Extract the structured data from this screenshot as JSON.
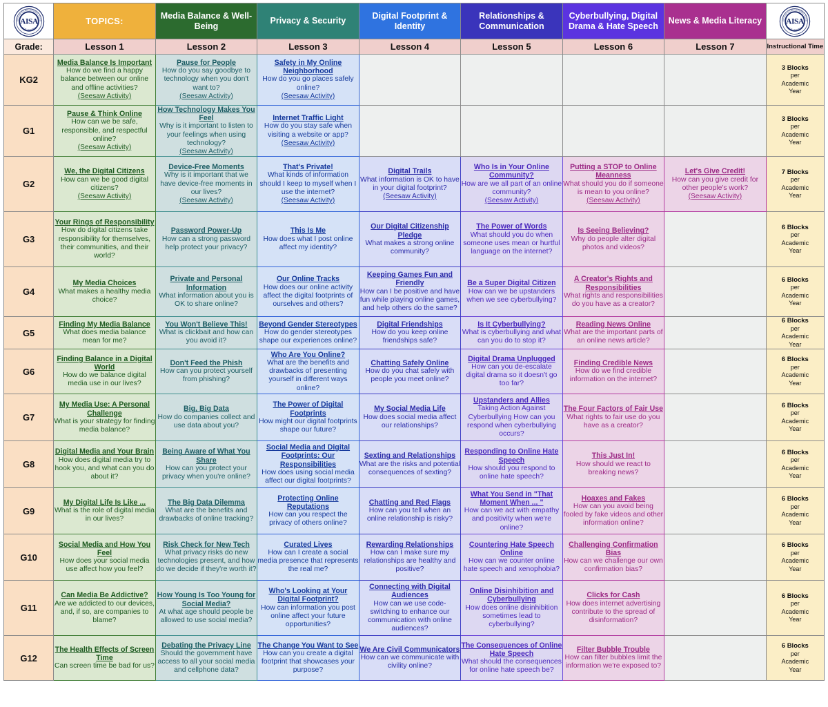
{
  "header": {
    "logo_alt": "AISA American International School Abu Dhabi",
    "topics_label": "TOPICS:",
    "strands": [
      "Media Balance & Well-Being",
      "Privacy & Security",
      "Digital Footprint & Identity",
      "Relationships & Communication",
      "Cyberbullying, Digital Drama & Hate Speech",
      "News & Media Literacy"
    ],
    "grade_label": "Grade:",
    "lesson_labels": [
      "Lesson 1",
      "Lesson 2",
      "Lesson 3",
      "Lesson 4",
      "Lesson 5",
      "Lesson 6",
      "Lesson 7"
    ],
    "time_label": "Instructional Time"
  },
  "colors": {
    "topics": "#efb13c",
    "media_balance": "#2c6b2f",
    "privacy": "#2f8276",
    "footprint": "#2f73e0",
    "relationships": "#3a34bb",
    "cyberbullying": "#5b33e0",
    "news": "#a9308f",
    "grade_col": "#fadfc4",
    "lesson_hdr": "#f0cfcc",
    "time_col": "#fbeec6"
  },
  "seesaw_label": "(Seesaw Activity)",
  "rows": [
    {
      "grade": "KG2",
      "time": {
        "blocks": "3 Blocks",
        "per": "per",
        "academic": "Academic",
        "year": "Year"
      },
      "cells": [
        {
          "title": "Media Balance Is Important",
          "question": "How do we find a happy balance between our online and offline activities?",
          "seesaw": "(Seesaw Activity)"
        },
        {
          "title": "Pause for People",
          "question": "How do you say goodbye to technology when you don't want to?",
          "seesaw": "(Seesaw Activity)"
        },
        {
          "title": "Safety in My Online Neighborhood",
          "question": "How do you go places safely online?",
          "seesaw": "(Seesaw Activity)"
        },
        {
          "title": "",
          "question": "",
          "seesaw": ""
        },
        {
          "title": "",
          "question": "",
          "seesaw": ""
        },
        {
          "title": "",
          "question": "",
          "seesaw": ""
        },
        {
          "title": "",
          "question": "",
          "seesaw": ""
        }
      ]
    },
    {
      "grade": "G1",
      "time": {
        "blocks": "3 Blocks",
        "per": "per",
        "academic": "Academic",
        "year": "Year"
      },
      "cells": [
        {
          "title": "Pause & Think Online",
          "question": "How can we be safe, responsible, and respectful online?",
          "seesaw": "(Seesaw Activity)"
        },
        {
          "title": "How Technology Makes You Feel",
          "question": "Why is it important to listen to your feelings when using technology?",
          "seesaw": "(Seesaw Activity)"
        },
        {
          "title": "Internet Traffic Light",
          "question": "How do you stay safe when visiting a website or app?",
          "seesaw": "(Seesaw Activity)"
        },
        {
          "title": "",
          "question": "",
          "seesaw": ""
        },
        {
          "title": "",
          "question": "",
          "seesaw": ""
        },
        {
          "title": "",
          "question": "",
          "seesaw": ""
        },
        {
          "title": "",
          "question": "",
          "seesaw": ""
        }
      ]
    },
    {
      "grade": "G2",
      "time": {
        "blocks": "7 Blocks",
        "per": "per",
        "academic": "Academic",
        "year": "Year"
      },
      "cells": [
        {
          "title": "We, the Digital Citizens",
          "question": "How can we be good digital citizens?",
          "seesaw": "(Seesaw Activity)"
        },
        {
          "title": "Device-Free Moments",
          "question": "Why is it important that we have device-free moments in our lives?",
          "seesaw": "(Seesaw Activity)"
        },
        {
          "title": "That's Private!",
          "question": "What kinds of information should I keep to myself when I use the internet?",
          "seesaw": "(Seesaw Activity)"
        },
        {
          "title": "Digital Trails",
          "question": "What information is OK to have in your digital footprint?",
          "seesaw": "(Seesaw Activity)"
        },
        {
          "title": "Who Is in Your Online Community?",
          "question": "How are we all part of an online community?",
          "seesaw": "(Seesaw Activity)"
        },
        {
          "title": "Putting a STOP to Online Meanness",
          "question": "What should you do if someone is mean to you online?",
          "seesaw": "(Seesaw Activity)"
        },
        {
          "title": "Let's Give Credit!",
          "question": "How can you give credit for other people's work?",
          "seesaw": "(Seesaw Activity)"
        }
      ]
    },
    {
      "grade": "G3",
      "time": {
        "blocks": "6 Blocks",
        "per": "per",
        "academic": "Academic",
        "year": "Year"
      },
      "cells": [
        {
          "title": "Your Rings of Responsibility",
          "question": "How do digital citizens take responsibility for themselves, their communities, and their world?",
          "seesaw": ""
        },
        {
          "title": "Password Power-Up",
          "question": "How can a strong password help protect your privacy?",
          "seesaw": ""
        },
        {
          "title": "This Is Me",
          "question": "How does what I post online affect my identity?",
          "seesaw": ""
        },
        {
          "title": "Our Digital Citizenship Pledge",
          "question": "What makes a strong online community?",
          "seesaw": ""
        },
        {
          "title": "The Power of Words",
          "question": "What should you do when someone uses mean or hurtful language on the internet?",
          "seesaw": ""
        },
        {
          "title": "Is Seeing Believing?",
          "question": "Why do people alter digital photos and videos?",
          "seesaw": ""
        },
        {
          "title": "",
          "question": "",
          "seesaw": ""
        }
      ]
    },
    {
      "grade": "G4",
      "time": {
        "blocks": "6 Blocks",
        "per": "per",
        "academic": "Academic",
        "year": "Year"
      },
      "cells": [
        {
          "title": "My Media Choices",
          "question": "What makes a healthy media choice?",
          "seesaw": ""
        },
        {
          "title": "Private and Personal Information",
          "question": "What information about you is OK to share online?",
          "seesaw": ""
        },
        {
          "title": "Our Online Tracks",
          "question": "How does our online activity affect the digital footprints of ourselves and others?",
          "seesaw": ""
        },
        {
          "title": "Keeping Games Fun and Friendly",
          "question": "How can I be positive and have fun while playing online games, and help others do the same?",
          "seesaw": ""
        },
        {
          "title": "Be a Super Digital Citizen",
          "question": "How can we be upstanders when we see cyberbullying?",
          "seesaw": ""
        },
        {
          "title": "A Creator's Rights and Responsibilities",
          "question": "What rights and responsibilities do you have as a creator?",
          "seesaw": ""
        },
        {
          "title": "",
          "question": "",
          "seesaw": ""
        }
      ]
    },
    {
      "grade": "G5",
      "time": {
        "blocks": "6 Blocks",
        "per": "per",
        "academic": "Academic",
        "year": "Year"
      },
      "cells": [
        {
          "title": "Finding My Media Balance",
          "question": "What does media balance mean for me?",
          "seesaw": ""
        },
        {
          "title": "You Won't Believe This!",
          "question": "What is clickbait and how can you avoid it?",
          "seesaw": ""
        },
        {
          "title": "Beyond Gender Stereotypes",
          "question": "How do gender stereotypes shape our experiences online?",
          "seesaw": ""
        },
        {
          "title": "Digital Friendships",
          "question": "How do you keep online friendships safe?",
          "seesaw": ""
        },
        {
          "title": "Is It Cyberbullying?",
          "question": "What is cyberbullying and what can you do to stop it?",
          "seesaw": ""
        },
        {
          "title": "Reading News Online",
          "question": "What are the important parts of an online news article?",
          "seesaw": ""
        },
        {
          "title": "",
          "question": "",
          "seesaw": ""
        }
      ]
    },
    {
      "grade": "G6",
      "time": {
        "blocks": "6 Blocks",
        "per": "per",
        "academic": "Academic",
        "year": "Year"
      },
      "cells": [
        {
          "title": "Finding Balance in a Digital World",
          "question": "How do we balance digital media use in our lives?",
          "seesaw": ""
        },
        {
          "title": "Don't Feed the Phish",
          "question": "How can you protect yourself from phishing?",
          "seesaw": ""
        },
        {
          "title": "Who Are You Online?",
          "question": "What are the benefits and drawbacks of presenting yourself in different ways online?",
          "seesaw": ""
        },
        {
          "title": "Chatting Safely Online",
          "question": "How do you chat safely with people you meet online?",
          "seesaw": ""
        },
        {
          "title": "Digital Drama Unplugged",
          "question": "How can you de-escalate digital drama so it doesn't go too far?",
          "seesaw": ""
        },
        {
          "title": "Finding Credible News",
          "question": "How do we find credible information on the internet?",
          "seesaw": ""
        },
        {
          "title": "",
          "question": "",
          "seesaw": ""
        }
      ]
    },
    {
      "grade": "G7",
      "time": {
        "blocks": "6 Blocks",
        "per": "per",
        "academic": "Academic",
        "year": "Year"
      },
      "cells": [
        {
          "title": "My Media Use: A Personal Challenge",
          "question": "What is your strategy for finding media balance?",
          "seesaw": ""
        },
        {
          "title": "Big, Big Data",
          "question": "How do companies collect and use data about you?",
          "seesaw": ""
        },
        {
          "title": "The Power of Digital Footprints",
          "question": "How might our digital footprints shape our future?",
          "seesaw": ""
        },
        {
          "title": "My Social Media Life",
          "question": "How does social media affect our relationships?",
          "seesaw": ""
        },
        {
          "title": "Upstanders and Allies",
          "question": "Taking Action Against Cyberbullying How can you respond when cyberbullying occurs?",
          "seesaw": ""
        },
        {
          "title": "The Four Factors of Fair Use",
          "question": "What rights to fair use do you have as a creator?",
          "seesaw": ""
        },
        {
          "title": "",
          "question": "",
          "seesaw": ""
        }
      ]
    },
    {
      "grade": "G8",
      "time": {
        "blocks": "6 Blocks",
        "per": "per",
        "academic": "Academic",
        "year": "Year"
      },
      "cells": [
        {
          "title": "Digital Media and Your Brain",
          "question": "How does digital media try to hook you, and what can you do about it?",
          "seesaw": ""
        },
        {
          "title": "Being Aware of What You Share",
          "question": "How can you protect your privacy when you're online?",
          "seesaw": ""
        },
        {
          "title": "Social Media and Digital Footprints: Our Responsibilities",
          "question": "How does using social media affect our digital footprints?",
          "seesaw": ""
        },
        {
          "title": "Sexting and Relationships",
          "question": "What are the risks and potential consequences of sexting?",
          "seesaw": ""
        },
        {
          "title": "Responding to Online Hate Speech",
          "question": "How should you respond to online hate speech?",
          "seesaw": ""
        },
        {
          "title": "This Just In!",
          "question": "How should we react to breaking news?",
          "seesaw": ""
        },
        {
          "title": "",
          "question": "",
          "seesaw": ""
        }
      ]
    },
    {
      "grade": "G9",
      "time": {
        "blocks": "6 Blocks",
        "per": "per",
        "academic": "Academic",
        "year": "Year"
      },
      "cells": [
        {
          "title": "My Digital Life Is Like ...",
          "question": "What is the role of digital media in our lives?",
          "seesaw": ""
        },
        {
          "title": "The Big Data Dilemma",
          "question": "What are the benefits and drawbacks of online tracking?",
          "seesaw": ""
        },
        {
          "title": "Protecting Online Reputations",
          "question": "How can you respect the privacy of others online?",
          "seesaw": ""
        },
        {
          "title": "Chatting and Red Flags",
          "question": "How can you tell when an online relationship is risky?",
          "seesaw": ""
        },
        {
          "title": "What You Send in \"That Moment When ... \"",
          "question": "How can we act with empathy and positivity when we're online?",
          "seesaw": ""
        },
        {
          "title": "Hoaxes and Fakes",
          "question": "How can you avoid being fooled by fake videos and other information online?",
          "seesaw": ""
        },
        {
          "title": "",
          "question": "",
          "seesaw": ""
        }
      ]
    },
    {
      "grade": "G10",
      "time": {
        "blocks": "6 Blocks",
        "per": "per",
        "academic": "Academic",
        "year": "Year"
      },
      "cells": [
        {
          "title": "Social Media and How You Feel",
          "question": "How does your social media use affect how you feel?",
          "seesaw": ""
        },
        {
          "title": "Risk Check for New Tech",
          "question": "What privacy risks do new technologies present, and how do we decide if they're worth it?",
          "seesaw": ""
        },
        {
          "title": "Curated Lives",
          "question": "How can I create a social media presence that represents the real me?",
          "seesaw": ""
        },
        {
          "title": "Rewarding Relationships",
          "question": "How can I make sure my relationships are healthy and positive?",
          "seesaw": ""
        },
        {
          "title": "Countering Hate Speech Online",
          "question": "How can we counter online hate speech and xenophobia?",
          "seesaw": ""
        },
        {
          "title": "Challenging Confirmation Bias",
          "question": "How can we challenge our own confirmation bias?",
          "seesaw": ""
        },
        {
          "title": "",
          "question": "",
          "seesaw": ""
        }
      ]
    },
    {
      "grade": "G11",
      "time": {
        "blocks": "6 Blocks",
        "per": "per",
        "academic": "Academic",
        "year": "Year"
      },
      "cells": [
        {
          "title": "Can Media Be Addictive?",
          "question": "Are we addicted to our devices, and, if so, are companies to blame?",
          "seesaw": ""
        },
        {
          "title": "How Young Is Too Young for Social Media?",
          "question": "At what age should people be allowed to use social media?",
          "seesaw": ""
        },
        {
          "title": "Who's Looking at Your Digital Footprint?",
          "question": "How can information you post online affect your future opportunities?",
          "seesaw": ""
        },
        {
          "title": "Connecting with Digital Audiences",
          "question": "How can we use code-switching to enhance our communication with online audiences?",
          "seesaw": ""
        },
        {
          "title": "Online Disinhibition and Cyberbullying",
          "question": "How does online disinhibition sometimes lead to cyberbullying?",
          "seesaw": ""
        },
        {
          "title": "Clicks for Cash",
          "question": "How does internet advertising contribute to the spread of disinformation?",
          "seesaw": ""
        },
        {
          "title": "",
          "question": "",
          "seesaw": ""
        }
      ]
    },
    {
      "grade": "G12",
      "time": {
        "blocks": "6 Blocks",
        "per": "per",
        "academic": "Academic",
        "year": "Year"
      },
      "cells": [
        {
          "title": "The Health Effects of Screen Time",
          "question": "Can screen time be bad for us?",
          "seesaw": ""
        },
        {
          "title": "Debating the Privacy Line",
          "question": "Should the government have access to all your social media and cellphone data?",
          "seesaw": ""
        },
        {
          "title": "The Change You Want to See",
          "question": "How can you create a digital footprint that showcases your purpose?",
          "seesaw": ""
        },
        {
          "title": "We Are Civil Communicators",
          "question": "How can we communicate with civility online?",
          "seesaw": ""
        },
        {
          "title": "The Consequences of Online Hate Speech",
          "question": "What should the consequences for online hate speech be?",
          "seesaw": ""
        },
        {
          "title": "Filter Bubble Trouble",
          "question": "How can filter bubbles limit the information we're exposed to?",
          "seesaw": ""
        },
        {
          "title": "",
          "question": "",
          "seesaw": ""
        }
      ]
    }
  ]
}
